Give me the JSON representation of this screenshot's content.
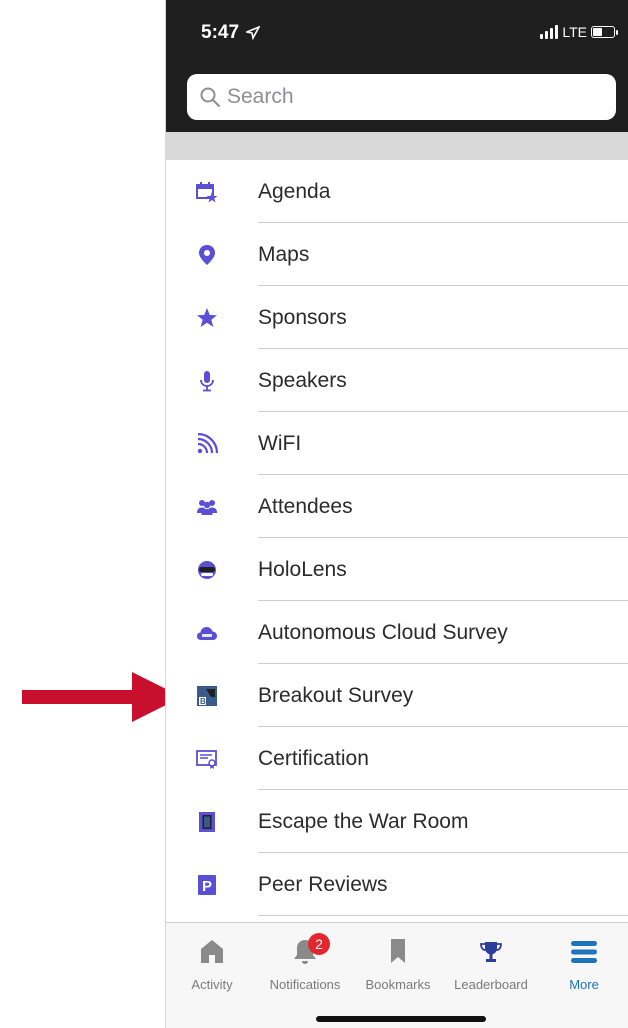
{
  "status_bar": {
    "time": "5:47",
    "network": "LTE"
  },
  "search": {
    "placeholder": "Search"
  },
  "menu": {
    "items": [
      {
        "label": "Agenda",
        "icon": "calendar-star-icon"
      },
      {
        "label": "Maps",
        "icon": "map-pin-icon"
      },
      {
        "label": "Sponsors",
        "icon": "star-icon"
      },
      {
        "label": "Speakers",
        "icon": "microphone-icon"
      },
      {
        "label": "WiFI",
        "icon": "wifi-icon"
      },
      {
        "label": "Attendees",
        "icon": "people-icon"
      },
      {
        "label": "HoloLens",
        "icon": "hololens-icon"
      },
      {
        "label": "Autonomous Cloud Survey",
        "icon": "acm-cloud-icon"
      },
      {
        "label": "Breakout Survey",
        "icon": "breakout-survey-icon"
      },
      {
        "label": "Certification",
        "icon": "certificate-icon"
      },
      {
        "label": "Escape the War Room",
        "icon": "door-icon"
      },
      {
        "label": "Peer Reviews",
        "icon": "p-parking-icon"
      }
    ]
  },
  "tabbar": {
    "tabs": [
      {
        "label": "Activity",
        "icon": "home-icon"
      },
      {
        "label": "Notifications",
        "icon": "bell-icon",
        "badge": "2"
      },
      {
        "label": "Bookmarks",
        "icon": "bookmark-icon"
      },
      {
        "label": "Leaderboard",
        "icon": "trophy-icon"
      },
      {
        "label": "More",
        "icon": "hamburger-icon"
      }
    ]
  },
  "colors": {
    "accent": "#1e73be",
    "icon_purple": "#5b4fd6",
    "badge_red": "#e4262f",
    "arrow_red": "#c8102e",
    "header": "#1f1f1f"
  }
}
